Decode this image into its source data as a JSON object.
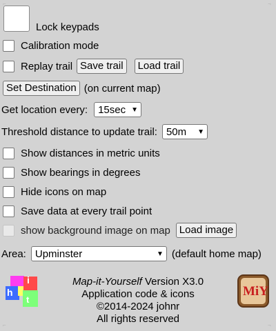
{
  "lock": {
    "label": "Lock keypads"
  },
  "calibration": {
    "label": "Calibration mode"
  },
  "replay": {
    "label": "Replay trail",
    "save_button": "Save trail",
    "load_button": "Load trail"
  },
  "destination": {
    "button": "Set Destination",
    "note": "(on current map)"
  },
  "location_interval": {
    "label": "Get location every:",
    "selected": "15sec"
  },
  "threshold": {
    "label": "Threshold distance to update trail:",
    "selected": "50m"
  },
  "options": [
    {
      "label": "Show distances in metric units",
      "checked": false
    },
    {
      "label": "Show bearings in degrees",
      "checked": false
    },
    {
      "label": "Hide icons on map",
      "checked": false
    },
    {
      "label": "Save data at every trail point",
      "checked": false
    }
  ],
  "background": {
    "label": "show background image on map",
    "button": "Load image",
    "disabled": true
  },
  "area": {
    "label": "Area:",
    "selected": "Upminster",
    "note": "(default home map)"
  },
  "about": {
    "app_name": "Map-it-Yourself",
    "version": " Version X3.0",
    "line2": "Application code & icons",
    "line3": "©2014-2024 johnr",
    "line4": "All rights reserved"
  },
  "logo_left": {
    "letters": [
      "h",
      "i",
      "t"
    ]
  },
  "logo_right": {
    "text": "MiY"
  },
  "colors": {
    "background": "#d3d3d3",
    "logo_pink": "#ff3df0",
    "logo_blue": "#3c6cff",
    "logo_green": "#7dff7a",
    "logo_yellow": "#ffff66",
    "logo_red": "#ff4a4a",
    "badge_brown": "#8b5a2b",
    "badge_red": "#c81e1e"
  }
}
